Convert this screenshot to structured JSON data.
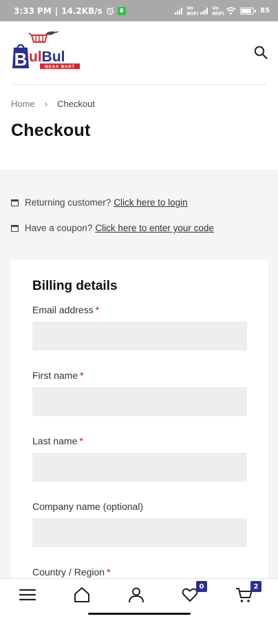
{
  "status_bar": {
    "time": "3:33 PM",
    "net_speed": "14.2KB/s",
    "notification_count": "8",
    "carrier_1": "Vo WiFi",
    "carrier_2": "Vo WiFi",
    "battery_level": "85",
    "battery_fraction": 0.85
  },
  "header": {
    "logo_brand": "BulBul",
    "logo_tagline": "MEGA MART",
    "search_icon": "search-icon"
  },
  "breadcrumb": {
    "home": "Home",
    "separator": "›",
    "current": "Checkout"
  },
  "page": {
    "title": "Checkout"
  },
  "notices": {
    "returning_prefix": "Returning customer?",
    "returning_link": "Click here to login",
    "coupon_prefix": "Have a coupon?",
    "coupon_link": "Click here to enter your code"
  },
  "billing": {
    "title": "Billing details",
    "required_mark": "*",
    "fields": {
      "email": {
        "label": "Email address",
        "value": ""
      },
      "first_name": {
        "label": "First name",
        "value": ""
      },
      "last_name": {
        "label": "Last name",
        "value": ""
      },
      "company": {
        "label": "Company name (optional)",
        "value": ""
      },
      "country": {
        "label": "Country / Region"
      }
    }
  },
  "bottom_nav": {
    "items": [
      {
        "name": "menu",
        "icon": "menu-icon"
      },
      {
        "name": "home",
        "icon": "home-icon"
      },
      {
        "name": "account",
        "icon": "user-icon"
      },
      {
        "name": "wishlist",
        "icon": "heart-icon",
        "badge": "0"
      },
      {
        "name": "cart",
        "icon": "cart-icon",
        "badge": "2"
      }
    ]
  },
  "colors": {
    "brand_blue": "#2c2f93",
    "brand_red": "#e0252b",
    "required_red": "#d0021b",
    "page_grey": "#f5f5f5",
    "input_grey": "#eeeeee"
  }
}
